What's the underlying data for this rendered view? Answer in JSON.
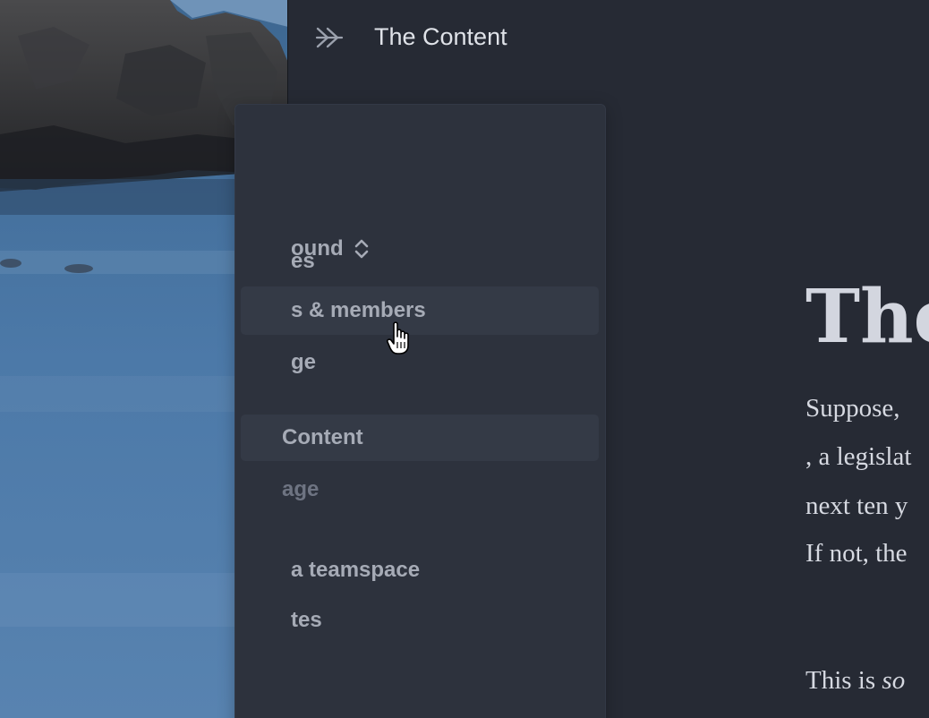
{
  "window": {
    "title": "The Content"
  },
  "sidebar": {
    "workspace_name": "ound",
    "items": [
      {
        "label": "es",
        "kind": "nav"
      },
      {
        "label": "s & members",
        "kind": "nav",
        "state": "hover"
      },
      {
        "label": "ge",
        "kind": "nav"
      },
      {
        "label": "Content",
        "kind": "page",
        "state": "selected"
      },
      {
        "label": "age",
        "kind": "page",
        "state": "muted"
      },
      {
        "label": "a teamspace",
        "kind": "action"
      },
      {
        "label": "tes",
        "kind": "nav"
      }
    ]
  },
  "content": {
    "heading": "The",
    "paragraph_lines": [
      "Suppose,",
      ", a legislat",
      "next ten y",
      "If not, the"
    ],
    "second_paragraph": {
      "plain": "This is ",
      "italic": "so"
    }
  },
  "icons": {
    "sidebar_toggle": "double-chevron-right-icon",
    "workspace_chevron": "chevron-up-down-icon",
    "cursor": "pointer-hand-cursor"
  },
  "colors": {
    "app_background": "#262a34",
    "sidebar_background": "#2d323d",
    "sidebar_hover": "#343a46",
    "sidebar_text": "#a6abb6",
    "sidebar_muted_text": "#6e7482",
    "title_text": "#dfe2e8",
    "content_text": "#d6d9e1"
  }
}
